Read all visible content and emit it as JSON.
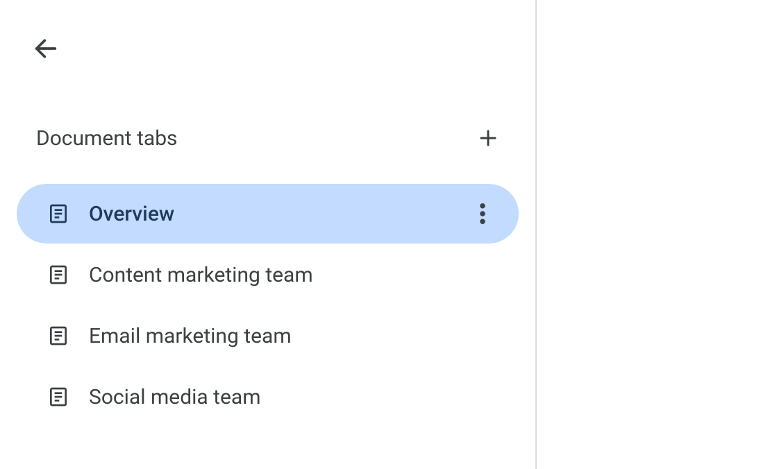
{
  "sidebar": {
    "section_title": "Document tabs",
    "tabs": [
      {
        "label": "Overview",
        "selected": true
      },
      {
        "label": "Content marketing team",
        "selected": false
      },
      {
        "label": "Email marketing team",
        "selected": false
      },
      {
        "label": "Social media team",
        "selected": false
      }
    ]
  }
}
